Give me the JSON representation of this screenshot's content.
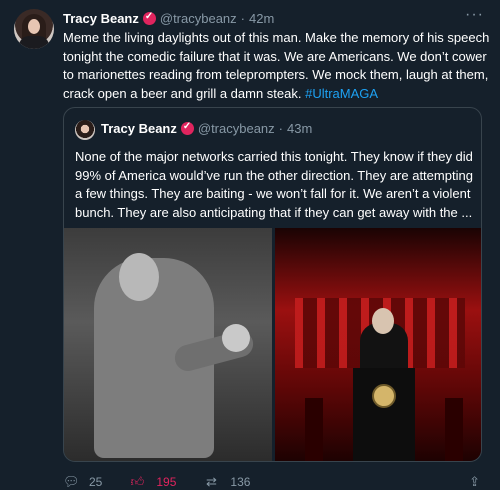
{
  "tweet": {
    "name": "Tracy Beanz",
    "handle": "@tracybeanz",
    "separator": "·",
    "time": "42m",
    "text": "Meme the living daylights out of this man. Make the memory of his speech tonight the comedic failure that it was. We are Americans. We don’t cower to marionettes reading from teleprompters. We mock them, laugh at them, crack open a beer and grill a damn steak.",
    "hashtag": "#UltraMAGA",
    "more_icon": "more-horizontal-icon"
  },
  "quote": {
    "name": "Tracy Beanz",
    "handle": "@tracybeanz",
    "separator": "·",
    "time": "43m",
    "text": "None of the major networks carried this tonight. They know if they did 99% of America would’ve run the other direction. They are attempting a few things. They are baiting - we won’t fall for it. We aren’t a violent bunch. They are also anticipating that if they can get away with the ..."
  },
  "actions": {
    "reply_count": "25",
    "like_count": "195",
    "retweet_count": "136",
    "colors": {
      "like": "#e0245e",
      "muted": "#8899a6",
      "link": "#1da1f2",
      "background": "#15202b"
    }
  }
}
